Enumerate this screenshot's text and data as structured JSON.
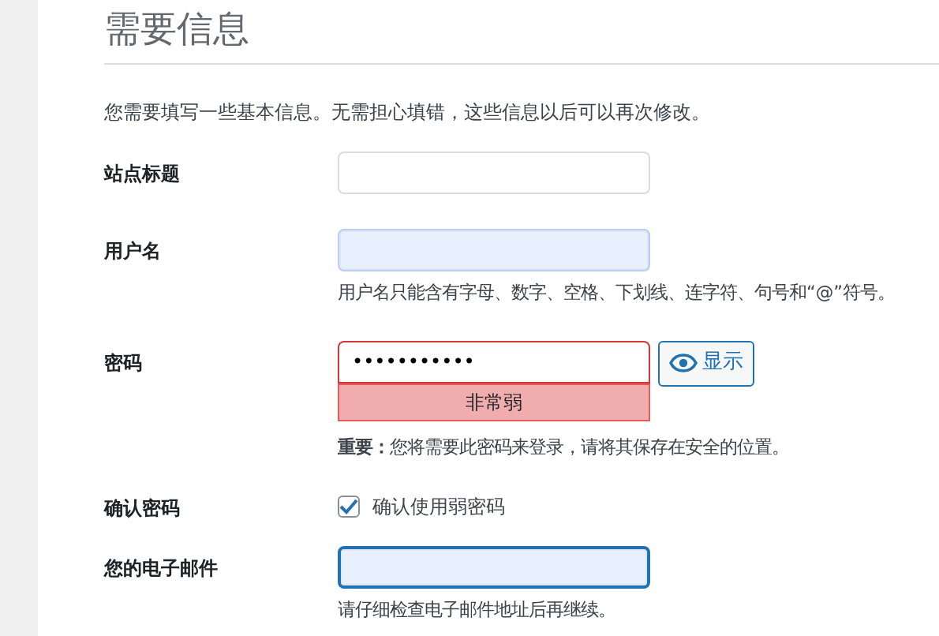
{
  "heading": "需要信息",
  "intro": "您需要填写一些基本信息。无需担心填错，这些信息以后可以再次修改。",
  "fields": [
    {
      "kind": "text",
      "label": "站点标题",
      "autofilled": false
    },
    {
      "kind": "text",
      "label": "用户名",
      "autofilled": true,
      "hint": "用户名只能含有字母、数字、空格、下划线、连字符、句号和“@”符号。"
    },
    {
      "kind": "password",
      "label": "密码",
      "value": "•••••••••••",
      "strength": "非常弱",
      "toggle": "显示",
      "hint": "**重要：**您将需要此密码来登录，请将其保存在安全的位置。"
    },
    {
      "kind": "checkbox",
      "label": "确认密码",
      "checked": true,
      "text": "确认使用弱密码"
    },
    {
      "kind": "text",
      "label": "您的电子邮件",
      "autofilled": true,
      "focused": true,
      "hint": "请仔细检查电子邮件地址后再继续。"
    }
  ]
}
